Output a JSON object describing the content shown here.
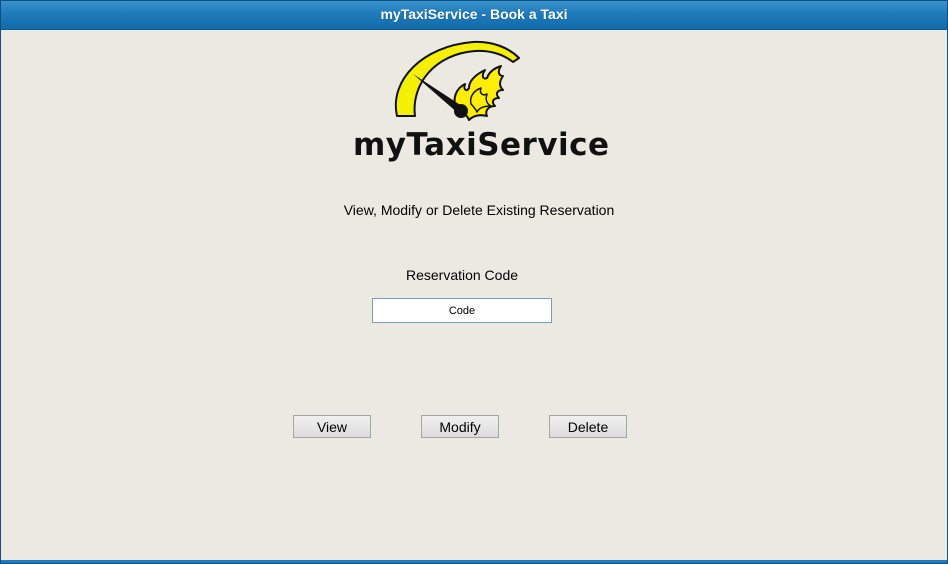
{
  "window": {
    "title": "myTaxiService - Book a Taxi"
  },
  "logo": {
    "text": "myTaxiService",
    "icon": "speedometer-flame-icon",
    "colors": {
      "gauge": "#f5f000",
      "flame": "#ffee00",
      "needle": "#111111"
    }
  },
  "main": {
    "subtitle": "View, Modify or Delete Existing Reservation",
    "code_label": "Reservation Code",
    "code_input": {
      "value": "",
      "placeholder": "Code"
    }
  },
  "buttons": {
    "view": "View",
    "modify": "Modify",
    "delete": "Delete"
  },
  "theme": {
    "titlebar": "#1f7bbb",
    "background": "#ece9e2"
  }
}
